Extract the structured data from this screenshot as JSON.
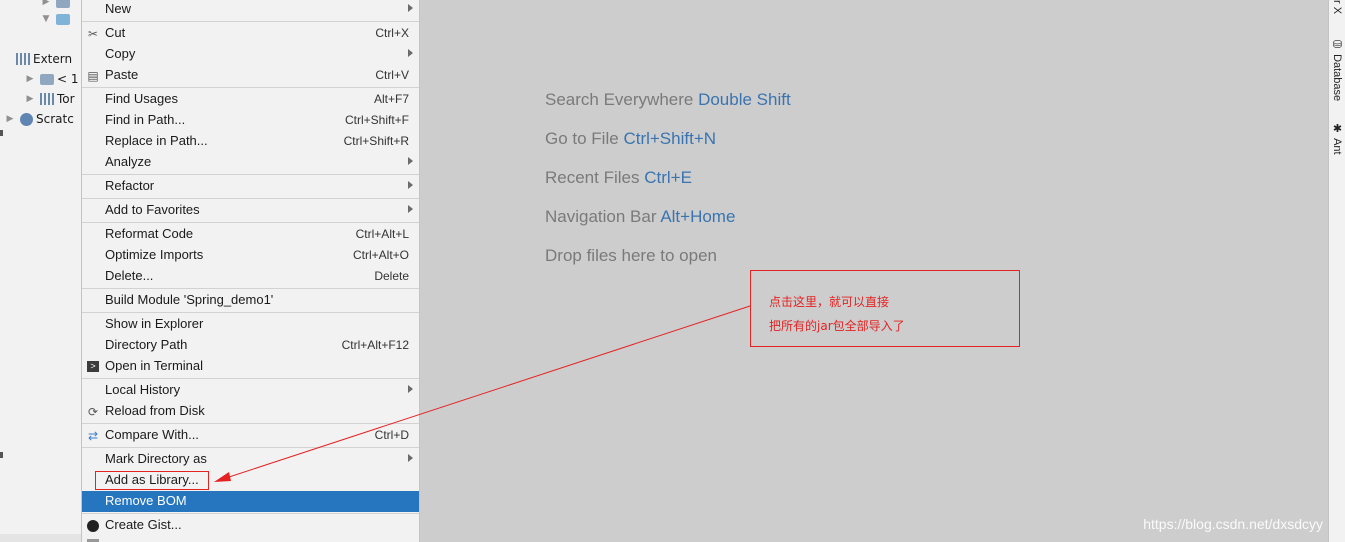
{
  "project_tree": {
    "items": [
      {
        "label": "Extern"
      },
      {
        "label": "< 1"
      },
      {
        "label": "Tor"
      },
      {
        "label": "Scratc"
      }
    ]
  },
  "context_menu": {
    "items": [
      {
        "label": "New",
        "shortcut": "",
        "submenu": true
      },
      {
        "label": "Cut",
        "shortcut": "Ctrl+X",
        "icon": "scissors-icon"
      },
      {
        "label": "Copy",
        "shortcut": "",
        "submenu": true
      },
      {
        "label": "Paste",
        "shortcut": "Ctrl+V",
        "icon": "clipboard-icon"
      },
      {
        "label": "Find Usages",
        "shortcut": "Alt+F7"
      },
      {
        "label": "Find in Path...",
        "shortcut": "Ctrl+Shift+F"
      },
      {
        "label": "Replace in Path...",
        "shortcut": "Ctrl+Shift+R"
      },
      {
        "label": "Analyze",
        "shortcut": "",
        "submenu": true
      },
      {
        "label": "Refactor",
        "shortcut": "",
        "submenu": true
      },
      {
        "label": "Add to Favorites",
        "shortcut": "",
        "submenu": true
      },
      {
        "label": "Reformat Code",
        "shortcut": "Ctrl+Alt+L"
      },
      {
        "label": "Optimize Imports",
        "shortcut": "Ctrl+Alt+O"
      },
      {
        "label": "Delete...",
        "shortcut": "Delete"
      },
      {
        "label": "Build Module 'Spring_demo1'",
        "shortcut": ""
      },
      {
        "label": "Show in Explorer",
        "shortcut": ""
      },
      {
        "label": "Directory Path",
        "shortcut": "Ctrl+Alt+F12"
      },
      {
        "label": "Open in Terminal",
        "shortcut": "",
        "icon": "terminal-icon"
      },
      {
        "label": "Local History",
        "shortcut": "",
        "submenu": true
      },
      {
        "label": "Reload from Disk",
        "shortcut": "",
        "icon": "reload-icon"
      },
      {
        "label": "Compare With...",
        "shortcut": "Ctrl+D",
        "icon": "compare-icon"
      },
      {
        "label": "Mark Directory as",
        "shortcut": "",
        "submenu": true
      },
      {
        "label": "Add as Library...",
        "shortcut": ""
      },
      {
        "label": "Remove BOM",
        "shortcut": "",
        "selected": true
      },
      {
        "label": "Create Gist...",
        "shortcut": "",
        "icon": "github-icon"
      }
    ]
  },
  "editor_hints": [
    {
      "text": "Search Everywhere",
      "key": "Double Shift"
    },
    {
      "text": "Go to File",
      "key": "Ctrl+Shift+N"
    },
    {
      "text": "Recent Files",
      "key": "Ctrl+E"
    },
    {
      "text": "Navigation Bar",
      "key": "Alt+Home"
    },
    {
      "text": "Drop files here to open",
      "key": ""
    }
  ],
  "annotation": {
    "line1": "点击这里，就可以直接",
    "line2": "把所有的jar包全部导入了"
  },
  "right_toolbar": {
    "tabs": [
      "r X",
      "Database",
      "Ant"
    ]
  },
  "watermark": "https://blog.csdn.net/dxsdcyy",
  "colors": {
    "selection": "#2675bf",
    "annotation_red": "#e52222",
    "hint_key_blue": "#3a74b0"
  }
}
